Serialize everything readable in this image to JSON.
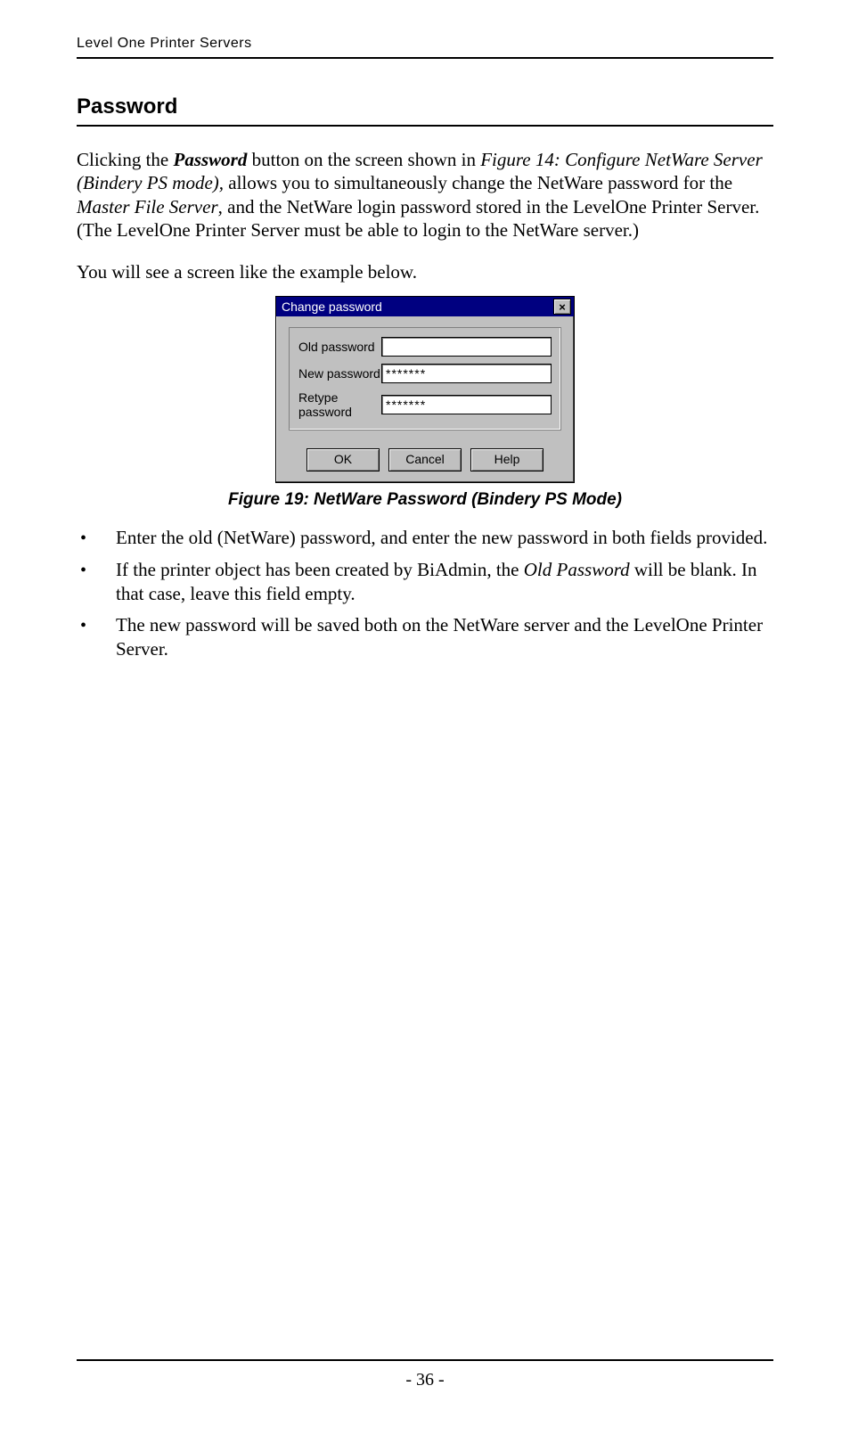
{
  "header": {
    "running": "Level One Printer Servers"
  },
  "section": {
    "title": "Password"
  },
  "para1": {
    "s1": "Clicking the ",
    "s2_bi": "Password",
    "s3": " button on the screen shown in ",
    "s4_i": "Figure 14: Configure NetWare Server (Bindery PS mode),",
    "s5": " allows you to simultaneously change the NetWare password for the ",
    "s6_i": "Master File Server",
    "s7": ", and the NetWare login password stored in the LevelOne Printer Server. (The LevelOne Printer Server must be able to login to the NetWare server.)"
  },
  "para2": "You will see a screen like the example below.",
  "dialog": {
    "title": "Change password",
    "close_glyph": "×",
    "labels": {
      "old": "Old password",
      "new": "New password",
      "retype": "Retype password"
    },
    "values": {
      "old": "",
      "new": "*******",
      "retype": "*******"
    },
    "buttons": {
      "ok": "OK",
      "cancel": "Cancel",
      "help": "Help"
    }
  },
  "figure_caption": "Figure 19: NetWare Password (Bindery PS Mode)",
  "bullets": {
    "b1": "Enter the old (NetWare) password, and enter the new password in both fields provided.",
    "b2_a": "If the printer object has been created by BiAdmin, the ",
    "b2_i": "Old Password",
    "b2_b": " will be blank. In that case, leave this field empty.",
    "b3": "The new password will be saved both on the NetWare server and the LevelOne Printer Server."
  },
  "footer": {
    "page": "- 36 -"
  }
}
